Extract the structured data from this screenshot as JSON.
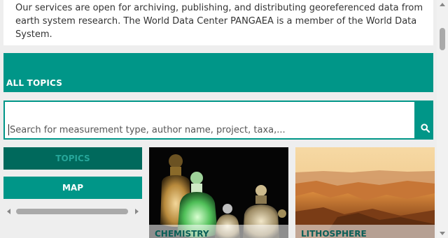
{
  "intro": {
    "text": "Our services are open for archiving, publishing, and distributing georeferenced data from earth system research. The World Data Center PANGAEA is a member of the World Data System."
  },
  "topics_header": {
    "label": "ALL TOPICS"
  },
  "search": {
    "placeholder": "Search for measurement type, author name, project, taxa,...",
    "value": "",
    "icon": "search-icon"
  },
  "tabs": [
    {
      "label": "TOPICS",
      "active": true
    },
    {
      "label": "MAP",
      "active": false
    }
  ],
  "tiles": [
    {
      "label": "CHEMISTRY"
    },
    {
      "label": "LITHOSPHERE"
    }
  ],
  "colors": {
    "accent": "#009688",
    "accent_dark": "#00695c",
    "tile_label": "#0b5f58"
  }
}
